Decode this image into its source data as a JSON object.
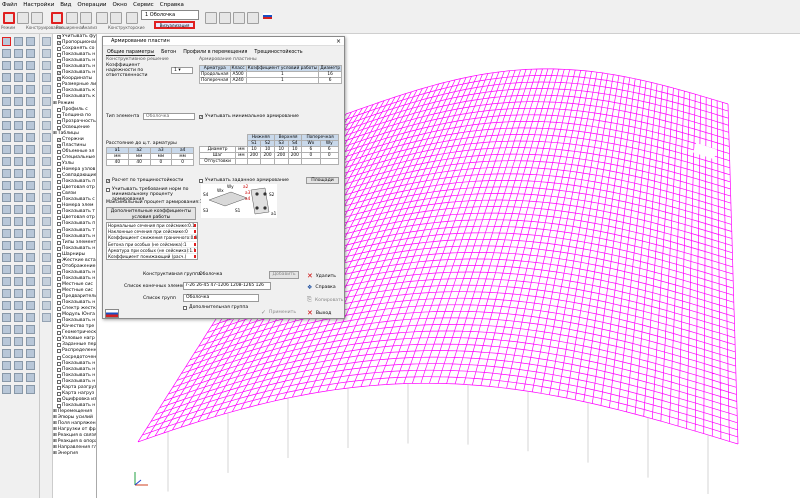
{
  "menu": [
    "Файл",
    "Настройки",
    "Вид",
    "Операции",
    "Окно",
    "Сервис",
    "Справка"
  ],
  "toolbar": {
    "doc_tab": "1 Оболочка",
    "mode_tab": "Визуализация",
    "labels": [
      "Режим",
      "Конструирование",
      "Расширенная",
      "Анализ",
      "Конструкторские"
    ]
  },
  "tree": {
    "items": [
      {
        "label": "Учитывать фу",
        "check": "on"
      },
      {
        "label": "Пропорционал",
        "check": "on"
      },
      {
        "label": "Сохранять со",
        "check": "off"
      },
      {
        "label": "Показывать н",
        "check": "off"
      },
      {
        "label": "Показывать н",
        "check": "off"
      },
      {
        "label": "Показывать н",
        "check": "on"
      },
      {
        "label": "Показывать н",
        "check": "on"
      },
      {
        "label": "Координаты",
        "check": "on"
      },
      {
        "label": "Размерные ли",
        "check": "off"
      },
      {
        "label": "Показывать к",
        "check": "off"
      },
      {
        "label": "Показывать к",
        "check": "off"
      },
      {
        "label": "Режим",
        "check": "none"
      },
      {
        "label": "Профиль с",
        "check": "off"
      },
      {
        "label": "Толщина по",
        "check": "off"
      },
      {
        "label": "Прозрачность",
        "check": "off"
      },
      {
        "label": "Освещение",
        "check": "off"
      },
      {
        "label": "Таблицы",
        "check": "none"
      },
      {
        "label": "Стержни",
        "check": "on"
      },
      {
        "label": "Пластины",
        "check": "on"
      },
      {
        "label": "Объемные эл",
        "check": "off"
      },
      {
        "label": "Специальные",
        "check": "off"
      },
      {
        "label": "Узлы",
        "check": "off"
      },
      {
        "label": "Номера узлов",
        "check": "off"
      },
      {
        "label": "Совпадающие",
        "check": "off"
      },
      {
        "label": "Показывать п",
        "check": "off"
      },
      {
        "label": "Цветовая отр",
        "check": "off"
      },
      {
        "label": "Связи",
        "check": "off"
      },
      {
        "label": "Показывать с",
        "check": "off"
      },
      {
        "label": "Номера элем",
        "check": "off"
      },
      {
        "label": "Показывать т",
        "check": "off"
      },
      {
        "label": "Цветовая отр",
        "check": "off"
      },
      {
        "label": "Показывать п",
        "check": "off"
      },
      {
        "label": "Показывать т",
        "check": "off"
      },
      {
        "label": "Показывать н",
        "check": "off"
      },
      {
        "label": "Типы элемент",
        "check": "off"
      },
      {
        "label": "Показывать н",
        "check": "off"
      },
      {
        "label": "Шарниры",
        "check": "off"
      },
      {
        "label": "Жесткие встав",
        "check": "on"
      },
      {
        "label": "Отображение",
        "check": "off"
      },
      {
        "label": "Показывать н",
        "check": "off"
      },
      {
        "label": "Показывать н",
        "check": "off"
      },
      {
        "label": "Местные сис",
        "check": "off"
      },
      {
        "label": "Местные сис",
        "check": "off"
      },
      {
        "label": "Предварительн",
        "check": "off"
      },
      {
        "label": "Показывать н",
        "check": "off"
      },
      {
        "label": "Спектр жестк",
        "check": "off"
      },
      {
        "label": "Модуль Юнга",
        "check": "off"
      },
      {
        "label": "Показывать н",
        "check": "off"
      },
      {
        "label": "Качество тре",
        "check": "off"
      },
      {
        "label": "Геометрическ",
        "check": "off"
      },
      {
        "label": "Узловые нагр",
        "check": "off"
      },
      {
        "label": "Заданные пер",
        "check": "off"
      },
      {
        "label": "Распределенн",
        "check": "off"
      },
      {
        "label": "Сосредоточен",
        "check": "off"
      },
      {
        "label": "Показывать н",
        "check": "off"
      },
      {
        "label": "Показывать н",
        "check": "off"
      },
      {
        "label": "Показывать н",
        "check": "off"
      },
      {
        "label": "Показывать н",
        "check": "off"
      },
      {
        "label": "Карта разгруз",
        "check": "off"
      },
      {
        "label": "Карта нагруз",
        "check": "off"
      },
      {
        "label": "Оцифровка из",
        "check": "on"
      },
      {
        "label": "Показывать н",
        "check": "off"
      },
      {
        "label": "Перемещения",
        "check": "none"
      },
      {
        "label": "Эпюры усилий",
        "check": "none"
      },
      {
        "label": "Поля напряжений",
        "check": "none"
      },
      {
        "label": "Нагрузки от фрагм",
        "check": "none"
      },
      {
        "label": "Реакция в связях",
        "check": "none"
      },
      {
        "label": "Реакция в опорах",
        "check": "none"
      },
      {
        "label": "Направления глав",
        "check": "none"
      },
      {
        "label": "Энергия",
        "check": "none"
      }
    ]
  },
  "dialog": {
    "title": "Армирование пластин",
    "close": "×",
    "tabs": [
      "Общие параметры",
      "Бетон",
      "Профили в перемещения",
      "Трещиностойкость"
    ],
    "constructive_header": "Конструктивное решение",
    "reliability_label": "Коэффициент надежности по ответственности",
    "reliability_value": "1",
    "plates_header": "Армирование пластины",
    "rebar_table": {
      "headers": [
        "Арматура",
        "Класс",
        "Коэффициент условий работы",
        "Диаметр"
      ],
      "rows": [
        [
          "Продольная",
          "A500",
          "1",
          "16"
        ],
        [
          "Поперечная",
          "A240",
          "1",
          "6"
        ]
      ]
    },
    "element_type_label": "Тип элемента",
    "element_type_value": "Оболочка",
    "min_rebar_label": "Учитывать минимальное армирование",
    "distance_header": "Расстояние до ц.т. арматуры",
    "distance_table": {
      "headers": [
        "a1",
        "a2",
        "a3",
        "a4"
      ],
      "units": [
        "мм",
        "мм",
        "мм",
        "мм"
      ],
      "values": [
        "40",
        "40",
        "0",
        "0"
      ]
    },
    "layer_table": {
      "groups": [
        "Нижняя",
        "Верхняя",
        "Поперечная"
      ],
      "sub": [
        "S1",
        "S2",
        "S3",
        "S4",
        "Wx",
        "Wy"
      ],
      "rows": [
        [
          "Диаметр",
          "мм",
          "10",
          "10",
          "10",
          "10",
          "6",
          "6"
        ],
        [
          "Шаг",
          "мм",
          "200",
          "200",
          "200",
          "200",
          "0",
          "0"
        ],
        [
          "Отпустовки",
          "",
          "",
          "",
          "",
          "",
          "",
          ""
        ]
      ]
    },
    "crack_label": "Расчет по трещиностойкости",
    "seismic_label": "Учитывать заданное армирование",
    "sites_button": "Площади",
    "extra_req_label": "Учитывать требования норм по минимальному проценту армирования",
    "max_percent_label": "Максимальный процент армирования:10",
    "extra_coef_button": "Дополнительные коэффициенты условия работы",
    "coef_list": [
      "Нормальные сечения при сейсмике:0.1",
      "Наклонные сечения при сейсмике:0",
      "Коэффициент снижения граничного:0.86",
      "Бетона при особых (не сейсмика):1",
      "Арматура при особых (не сейсмика):1.1",
      "Коэффициент понижающий (расч.)"
    ],
    "diagram_labels": [
      "S4",
      "S3",
      "S1",
      "S2",
      "a1",
      "a2",
      "a3",
      "a4",
      "Wx",
      "Wy"
    ],
    "group_label": "Конструктивная группа",
    "group_value": "Оболочка",
    "add_button": "Добавить",
    "delete_button": "Удалить",
    "elements_label": "Список конечных элементов",
    "elements_value": "7-26 26-45 47-1206 1208-1265 126",
    "help_button": "Справка",
    "list_label": "Список групп",
    "list_value": "Оболочка",
    "copy_button": "Копировать",
    "additional_group_label": "Дополнительная группа",
    "apply_button": "Применить",
    "exit_button": "Выход"
  },
  "colors": {
    "mesh": "#ff00ff",
    "highlight": "#e02020",
    "header_cell": "#c8d8ea"
  }
}
